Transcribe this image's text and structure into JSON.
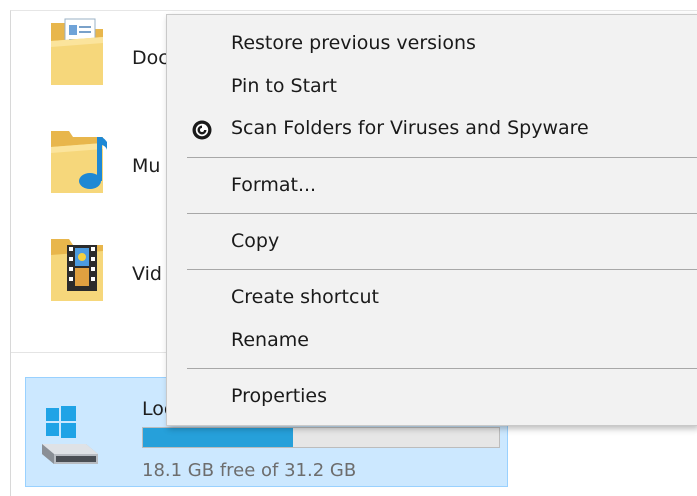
{
  "explorer": {
    "folders": [
      {
        "label": "Doc",
        "icon": "documents-folder-icon"
      },
      {
        "label": "Mu",
        "icon": "music-folder-icon"
      },
      {
        "label": "Vid",
        "icon": "videos-folder-icon"
      }
    ],
    "drive": {
      "name": "Loc",
      "icon": "windows-drive-icon",
      "used_fraction": 0.42,
      "free_text": "18.1 GB free of 31.2 GB"
    }
  },
  "context_menu": {
    "items": [
      {
        "label": "Restore previous versions"
      },
      {
        "label": "Pin to Start"
      },
      {
        "label": "Scan Folders for Viruses and Spyware",
        "icon": "antivirus-scan-icon"
      },
      {
        "label": "Format..."
      },
      {
        "label": "Copy"
      },
      {
        "label": "Create shortcut"
      },
      {
        "label": "Rename"
      },
      {
        "label": "Properties"
      }
    ]
  },
  "colors": {
    "selection": "#cce8ff",
    "selection_border": "#99d1ff",
    "bar_fill": "#26a0da",
    "menu_bg": "#f2f2f2"
  }
}
